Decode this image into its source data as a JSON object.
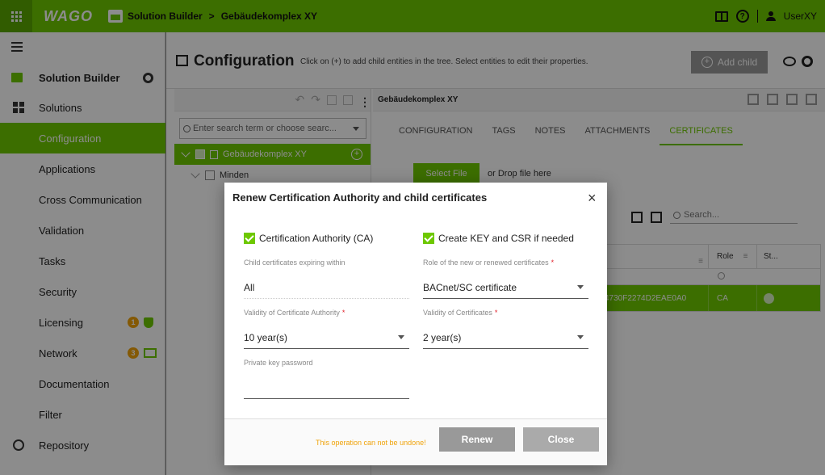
{
  "header": {
    "logo": "WAGO",
    "breadcrumb": [
      "Solution Builder",
      "Gebäudekomplex XY"
    ],
    "user": "UserXY"
  },
  "sidebar": {
    "title": "Solution Builder",
    "items": [
      {
        "label": "Solutions"
      },
      {
        "label": "Configuration",
        "active": true
      },
      {
        "label": "Applications"
      },
      {
        "label": "Cross Communication"
      },
      {
        "label": "Validation"
      },
      {
        "label": "Tasks"
      },
      {
        "label": "Security"
      },
      {
        "label": "Licensing",
        "badge": "1"
      },
      {
        "label": "Network",
        "badge": "3"
      },
      {
        "label": "Documentation"
      },
      {
        "label": "Filter"
      },
      {
        "label": "Repository"
      }
    ]
  },
  "main": {
    "title": "Configuration",
    "hint": "Click on (+) to add child entities in the tree. Select entities to edit their properties.",
    "add_child": "Add child",
    "tree": {
      "search_placeholder": "Enter search term or choose searc...",
      "nodes": [
        {
          "label": "Gebäudekomplex XY"
        },
        {
          "label": "Minden"
        }
      ]
    },
    "detail": {
      "entity": "Gebäudekomplex XY",
      "tabs": [
        "CONFIGURATION",
        "TAGS",
        "NOTES",
        "ATTACHMENTS",
        "CERTIFICATES"
      ],
      "active_tab": "CERTIFICATES",
      "select_file": "Select File",
      "drop_hint": "or Drop file here",
      "search_placeholder": "Search...",
      "table": {
        "columns": [
          "",
          "Role",
          "St..."
        ],
        "rows": [
          {
            "id": "4730F2274D2EAE0A0",
            "role": "CA"
          }
        ]
      }
    }
  },
  "modal": {
    "title": "Renew Certification Authority and child certificates",
    "close": "×",
    "check_ca": "Certification Authority (CA)",
    "check_key": "Create KEY and CSR if needed",
    "child_expiring_label": "Child certificates expiring within",
    "child_expiring_value": "All",
    "role_label": "Role of the new or renewed certificates",
    "role_value": "BACnet/SC certificate",
    "validity_ca_label": "Validity of Certificate Authority",
    "validity_ca_value": "10 year(s)",
    "validity_cert_label": "Validity of Certificates",
    "validity_cert_value": "2 year(s)",
    "pk_password_label": "Private key password",
    "warning": "This operation can not be undone!",
    "renew": "Renew",
    "close_button": "Close",
    "required_mark": "*"
  },
  "colors": {
    "accent": "#6ec800",
    "warning": "#f0a30a",
    "required": "#e0202a"
  }
}
